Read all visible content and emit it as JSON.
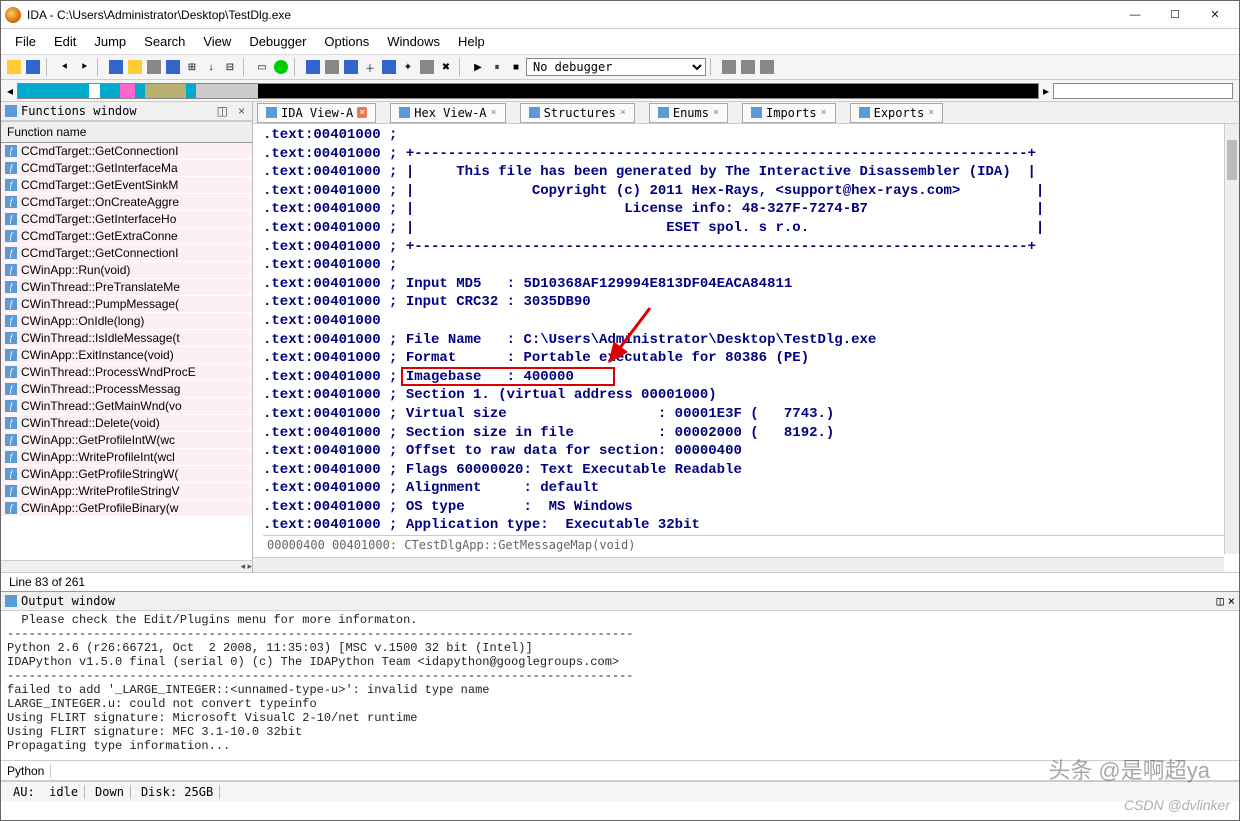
{
  "title": "IDA - C:\\Users\\Administrator\\Desktop\\TestDlg.exe",
  "menu": [
    "File",
    "Edit",
    "Jump",
    "Search",
    "View",
    "Debugger",
    "Options",
    "Windows",
    "Help"
  ],
  "toolbar": {
    "debugger_select": "No debugger"
  },
  "funcwin": {
    "title": "Functions window",
    "column": "Function name",
    "items": [
      "CCmdTarget::GetConnectionI",
      "CCmdTarget::GetInterfaceMa",
      "CCmdTarget::GetEventSinkM",
      "CCmdTarget::OnCreateAggre",
      "CCmdTarget::GetInterfaceHo",
      "CCmdTarget::GetExtraConne",
      "CCmdTarget::GetConnectionI",
      "CWinApp::Run(void)",
      "CWinThread::PreTranslateMe",
      "CWinThread::PumpMessage(",
      "CWinApp::OnIdle(long)",
      "CWinThread::IsIdleMessage(t",
      "CWinApp::ExitInstance(void)",
      "CWinThread::ProcessWndProcE",
      "CWinThread::ProcessMessag",
      "CWinThread::GetMainWnd(vo",
      "CWinThread::Delete(void)",
      "CWinApp::GetProfileIntW(wc",
      "CWinApp::WriteProfileInt(wcl",
      "CWinApp::GetProfileStringW(",
      "CWinApp::WriteProfileStringV",
      "CWinApp::GetProfileBinary(w"
    ]
  },
  "statusline": "Line 83 of 261",
  "tabs": [
    {
      "label": "IDA View-A",
      "active": true
    },
    {
      "label": "Hex View-A",
      "active": false
    },
    {
      "label": "Structures",
      "active": false
    },
    {
      "label": "Enums",
      "active": false
    },
    {
      "label": "Imports",
      "active": false
    },
    {
      "label": "Exports",
      "active": false
    }
  ],
  "disasm": {
    "addr": ".text:00401000",
    "lines": [
      ";",
      "; +-------------------------------------------------------------------------+",
      "; |     This file has been generated by The Interactive Disassembler (IDA)  |",
      "; |              Copyright (c) 2011 Hex-Rays, <support@hex-rays.com>         |",
      "; |                         License info: 48-327F-7274-B7                    |",
      "; |                              ESET spol. s r.o.                           |",
      "; +-------------------------------------------------------------------------+",
      ";",
      "; Input MD5   : 5D10368AF129994E813DF04EACA84811",
      "; Input CRC32 : 3035DB90",
      "",
      "; File Name   : C:\\Users\\Administrator\\Desktop\\TestDlg.exe",
      "; Format      : Portable executable for 80386 (PE)",
      "; Imagebase   : 400000",
      "; Section 1. (virtual address 00001000)",
      "; Virtual size                  : 00001E3F (   7743.)",
      "; Section size in file          : 00002000 (   8192.)",
      "; Offset to raw data for section: 00000400",
      "; Flags 60000020: Text Executable Readable",
      "; Alignment     : default",
      "; OS type       :  MS Windows",
      "; Application type:  Executable 32bit"
    ],
    "footer": "00000400 00401000: CTestDlgApp::GetMessageMap(void)"
  },
  "outwin": {
    "title": "Output window",
    "lines": [
      "  Please check the Edit/Plugins menu for more informaton.",
      "---------------------------------------------------------------------------------------",
      "Python 2.6 (r26:66721, Oct  2 2008, 11:35:03) [MSC v.1500 32 bit (Intel)]",
      "IDAPython v1.5.0 final (serial 0) (c) The IDAPython Team <idapython@googlegroups.com>",
      "---------------------------------------------------------------------------------------",
      "failed to add '_LARGE_INTEGER::<unnamed-type-u>': invalid type name",
      "LARGE_INTEGER.u: could not convert typeinfo",
      "Using FLIRT signature: Microsoft VisualC 2-10/net runtime",
      "Using FLIRT signature: MFC 3.1-10.0 32bit",
      "Propagating type information..."
    ]
  },
  "python_label": "Python",
  "status": {
    "au": "AU:",
    "idle": "idle",
    "down": "Down",
    "disk": "Disk: 25GB"
  },
  "watermark1": "头条 @是啊超ya",
  "watermark2": "CSDN @dvlinker"
}
